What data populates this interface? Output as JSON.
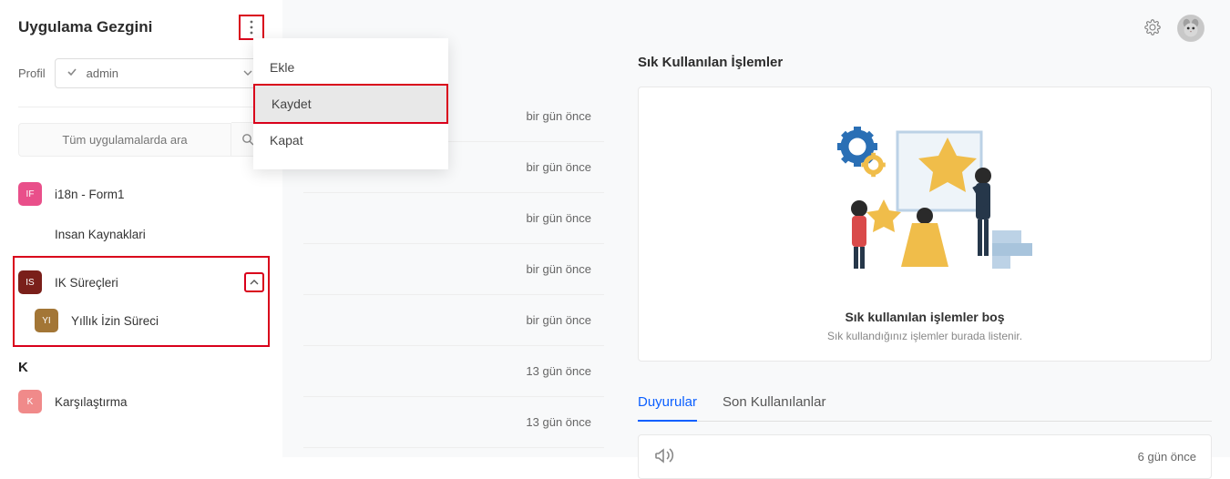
{
  "sidebar": {
    "title": "Uygulama Gezgini",
    "profile_label": "Profil",
    "profile_value": "admin",
    "search_placeholder": "Tüm uygulamalarda ara",
    "items": [
      {
        "badge": "IF",
        "color": "#e94f8a",
        "label": "i18n - Form1"
      },
      {
        "label": "Insan Kaynaklari"
      },
      {
        "badge": "IS",
        "color": "#7a1f1a",
        "label": "IK Süreçleri"
      },
      {
        "badge": "YI",
        "color": "#a37636",
        "label": "Yıllık İzin Süreci"
      }
    ],
    "letter_header": "K",
    "items2": [
      {
        "badge": "K",
        "color": "#f08a8a",
        "label": "Karşılaştırma"
      }
    ]
  },
  "dropdown": {
    "items": [
      "Ekle",
      "Kaydet",
      "Kapat"
    ]
  },
  "middle": {
    "dates": [
      "bir gün önce",
      "bir gün önce",
      "bir gün önce",
      "bir gün önce",
      "bir gün önce",
      "13 gün önce",
      "13 gün önce"
    ]
  },
  "main": {
    "favs_title": "Sık Kullanılan İşlemler",
    "favs_empty_title": "Sık kullanılan işlemler boş",
    "favs_empty_sub": "Sık kullandığınız işlemler burada listenir.",
    "tabs": [
      "Duyurular",
      "Son Kullanılanlar"
    ],
    "ann_time": "6 gün önce"
  },
  "colors": {
    "hl": "#d9001b",
    "accent": "#0b5fff"
  }
}
